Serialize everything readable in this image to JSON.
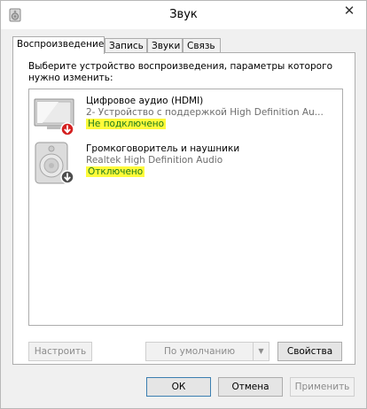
{
  "window": {
    "title": "Звук",
    "close_glyph": "✕"
  },
  "tabs": [
    {
      "label": "Воспроизведение",
      "active": true
    },
    {
      "label": "Запись",
      "active": false
    },
    {
      "label": "Звуки",
      "active": false
    },
    {
      "label": "Связь",
      "active": false
    }
  ],
  "panel": {
    "description": "Выберите устройство воспроизведения, параметры которого нужно изменить:"
  },
  "devices": [
    {
      "name": "Цифровое аудио (HDMI)",
      "subtitle": "2- Устройство с поддержкой High Definition Au...",
      "status": "Не подключено",
      "icon": "monitor-icon",
      "badge": "red-down-arrow"
    },
    {
      "name": "Громкоговоритель и наушники",
      "subtitle": "Realtek High Definition Audio",
      "status": "Отключено",
      "icon": "speaker-icon",
      "badge": "gray-down-arrow"
    }
  ],
  "panel_buttons": {
    "configure": "Настроить",
    "set_default": "По умолчанию",
    "properties": "Свойства"
  },
  "dialog_buttons": {
    "ok": "ОК",
    "cancel": "Отмена",
    "apply": "Применить"
  },
  "colors": {
    "status_text": "#1c7a1c",
    "highlight": "#fffa3a",
    "badge_red": "#d42020",
    "badge_gray": "#4d4d4d"
  }
}
